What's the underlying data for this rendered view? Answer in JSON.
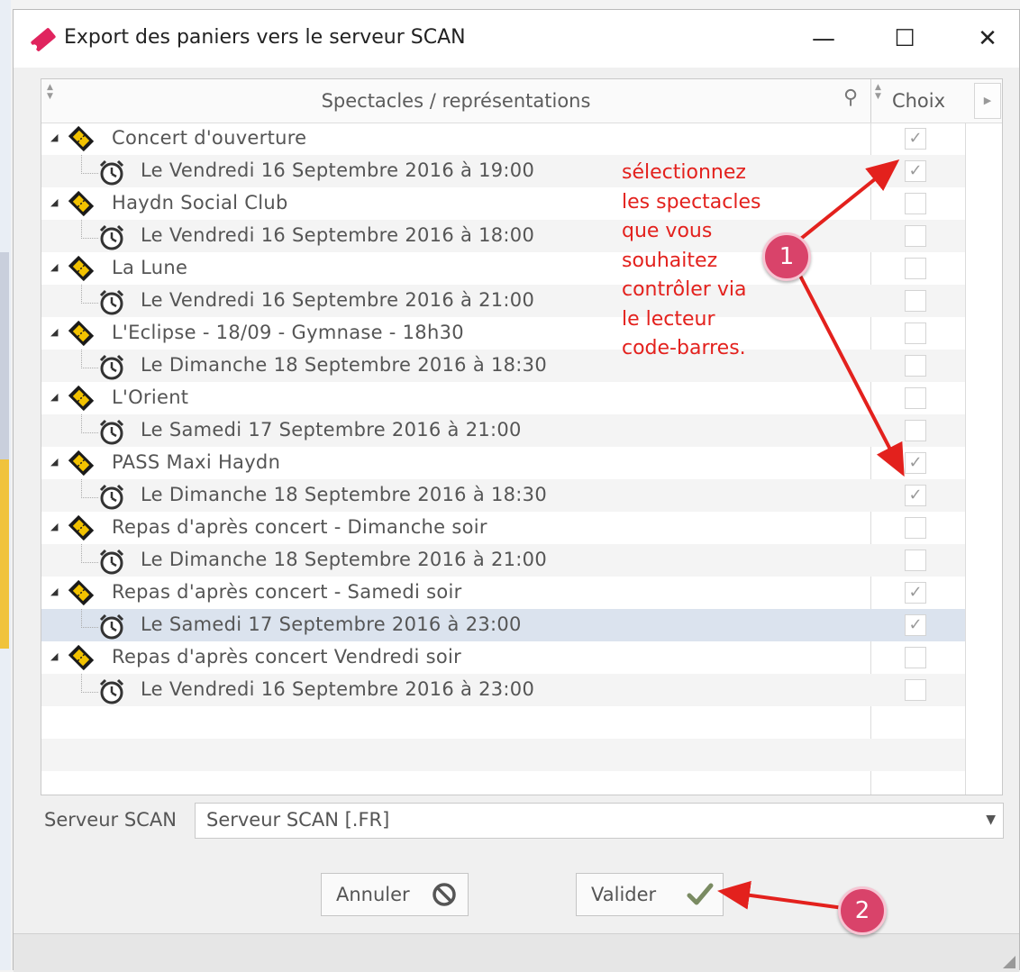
{
  "window": {
    "title": "Export des paniers vers le serveur SCAN",
    "minimize": "—",
    "maximize": "☐",
    "close": "✕"
  },
  "grid": {
    "header_spectacles": "Spectacles / représentations",
    "header_choix": "Choix",
    "rows": [
      {
        "type": "spectacle",
        "label": "Concert d'ouverture",
        "checked": true
      },
      {
        "type": "representation",
        "label": "Le Vendredi 16 Septembre 2016 à 19:00",
        "checked": true
      },
      {
        "type": "spectacle",
        "label": "Haydn Social Club",
        "checked": false
      },
      {
        "type": "representation",
        "label": "Le Vendredi 16 Septembre 2016 à 18:00",
        "checked": false
      },
      {
        "type": "spectacle",
        "label": "La Lune",
        "checked": false
      },
      {
        "type": "representation",
        "label": "Le Vendredi 16 Septembre 2016 à 21:00",
        "checked": false
      },
      {
        "type": "spectacle",
        "label": "L'Eclipse - 18/09 - Gymnase - 18h30",
        "checked": false
      },
      {
        "type": "representation",
        "label": "Le Dimanche 18 Septembre 2016 à 18:30",
        "checked": false
      },
      {
        "type": "spectacle",
        "label": "L'Orient",
        "checked": false
      },
      {
        "type": "representation",
        "label": "Le Samedi 17 Septembre 2016 à 21:00",
        "checked": false
      },
      {
        "type": "spectacle",
        "label": "PASS Maxi Haydn",
        "checked": true
      },
      {
        "type": "representation",
        "label": "Le Dimanche 18 Septembre 2016 à 18:30",
        "checked": true
      },
      {
        "type": "spectacle",
        "label": "Repas d'après concert - Dimanche soir",
        "checked": false
      },
      {
        "type": "representation",
        "label": "Le Dimanche 18 Septembre 2016 à 21:00",
        "checked": false
      },
      {
        "type": "spectacle",
        "label": "Repas d'après concert - Samedi soir",
        "checked": true
      },
      {
        "type": "representation",
        "label": "Le Samedi 17 Septembre 2016 à 23:00",
        "checked": true,
        "selected": true
      },
      {
        "type": "spectacle",
        "label": "Repas d'après concert Vendredi soir",
        "checked": false
      },
      {
        "type": "representation",
        "label": "Le Vendredi 16 Septembre 2016 à 23:00",
        "checked": false
      }
    ]
  },
  "annotation": {
    "lines": [
      "sélectionnez",
      "les spectacles",
      "que vous",
      "souhaitez",
      "contrôler via",
      "le lecteur",
      "code-barres."
    ],
    "badge1": "1",
    "badge2": "2",
    "color": "#e3211d"
  },
  "server": {
    "label": "Serveur SCAN",
    "value": "Serveur SCAN [.FR]"
  },
  "buttons": {
    "cancel": "Annuler",
    "ok": "Valider"
  },
  "colors": {
    "accent_ok": "#7a8b62",
    "selected_row": "#dbe3ee",
    "badge": "#d9436a"
  }
}
